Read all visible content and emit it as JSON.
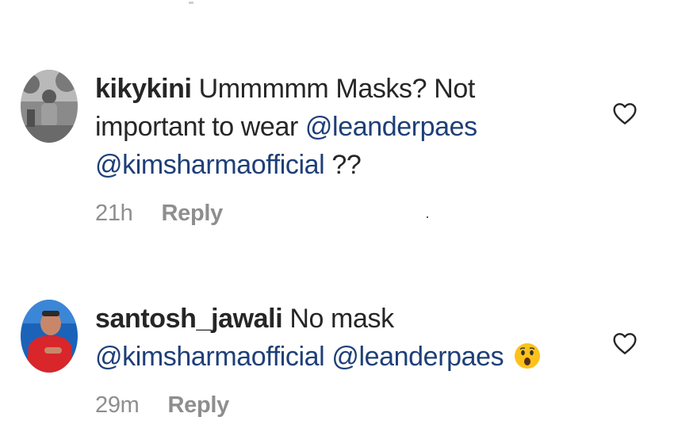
{
  "comments": [
    {
      "username": "kikykini",
      "text": "Ummmmm Masks? Not important to wear",
      "mentions": [
        "@leanderpaes",
        "@kimsharmaofficial"
      ],
      "suffix": "??",
      "time": "21h",
      "reply_label": "Reply"
    },
    {
      "username": "santosh_jawali",
      "text": "No mask",
      "mentions": [
        "@kimsharmaofficial",
        "@leanderpaes"
      ],
      "emoji": "astonished-face",
      "time": "29m",
      "reply_label": "Reply"
    }
  ],
  "colors": {
    "text": "#262626",
    "mention": "#1e3f78",
    "muted": "#8e8e8e",
    "background": "#ffffff"
  },
  "icons": [
    "heart-outline-icon",
    "astonished-face-emoji"
  ]
}
